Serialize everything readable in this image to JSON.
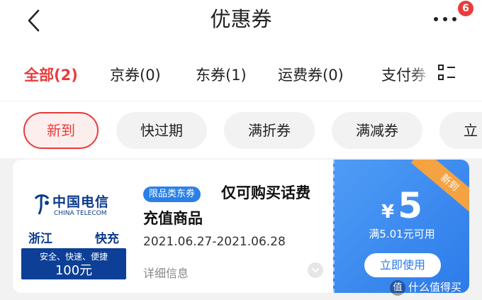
{
  "header": {
    "title": "优惠券",
    "notification_count": "6"
  },
  "tabs": [
    {
      "label": "全部(2)",
      "active": true
    },
    {
      "label": "京券(0)"
    },
    {
      "label": "东券(1)"
    },
    {
      "label": "运费券(0)"
    },
    {
      "label": "支付券"
    }
  ],
  "filters": [
    {
      "label": "新到",
      "active": true
    },
    {
      "label": "快过期"
    },
    {
      "label": "满折券"
    },
    {
      "label": "满减券"
    },
    {
      "label": "立"
    }
  ],
  "coupon": {
    "logo": {
      "brand_cn": "中国电信",
      "brand_en": "CHINA TELECOM",
      "region": "浙江",
      "type": "快充",
      "slogan": "安全、快速、便捷",
      "amount": "100元"
    },
    "scope_tag": "限品类东券",
    "title_line1": "仅可购买话费",
    "title_line2": "充值商品",
    "dates": "2021.06.27-2021.06.28",
    "detail_label": "详细信息",
    "new_ribbon": "新到",
    "currency": "¥",
    "value": "5",
    "condition": "满5.01元可用",
    "use_label": "立即使用"
  },
  "watermark": {
    "text": "什么值得买",
    "logo": "值"
  },
  "colors": {
    "accent_red": "#e93b3b",
    "coupon_blue": "#2c7be9",
    "ribbon_orange": "#f5a243",
    "telecom_blue": "#0c3f95"
  }
}
